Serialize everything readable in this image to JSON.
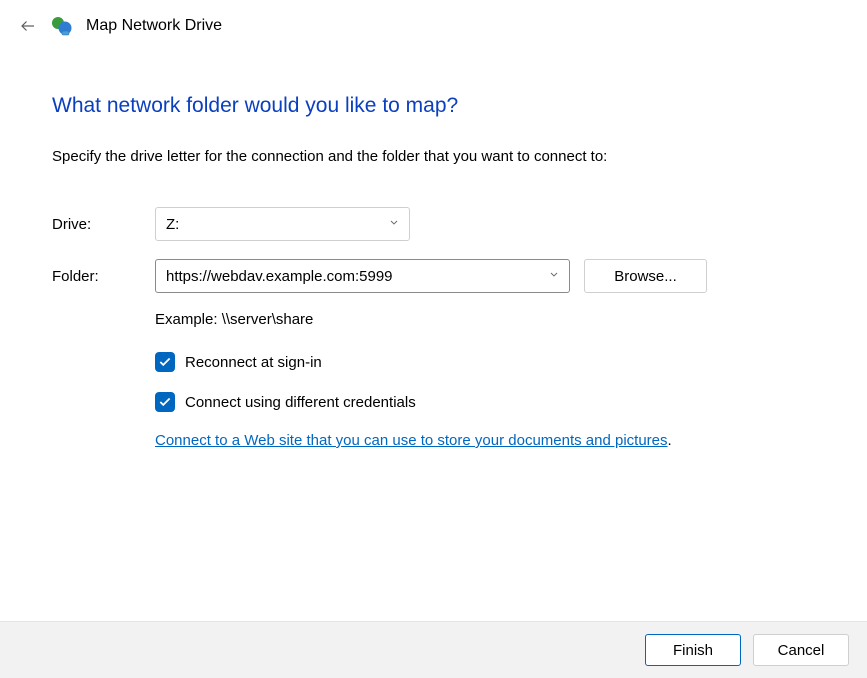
{
  "window": {
    "title": "Map Network Drive"
  },
  "page": {
    "heading": "What network folder would you like to map?",
    "subheading": "Specify the drive letter for the connection and the folder that you want to connect to:"
  },
  "form": {
    "drive_label": "Drive:",
    "drive_value": "Z:",
    "folder_label": "Folder:",
    "folder_value": "https://webdav.example.com:5999",
    "browse_label": "Browse...",
    "example_text": "Example: \\\\server\\share",
    "reconnect_label": "Reconnect at sign-in",
    "reconnect_checked": true,
    "credentials_label": "Connect using different credentials",
    "credentials_checked": true,
    "website_link": "Connect to a Web site that you can use to store your documents and pictures",
    "website_link_period": "."
  },
  "footer": {
    "finish_label": "Finish",
    "cancel_label": "Cancel"
  }
}
